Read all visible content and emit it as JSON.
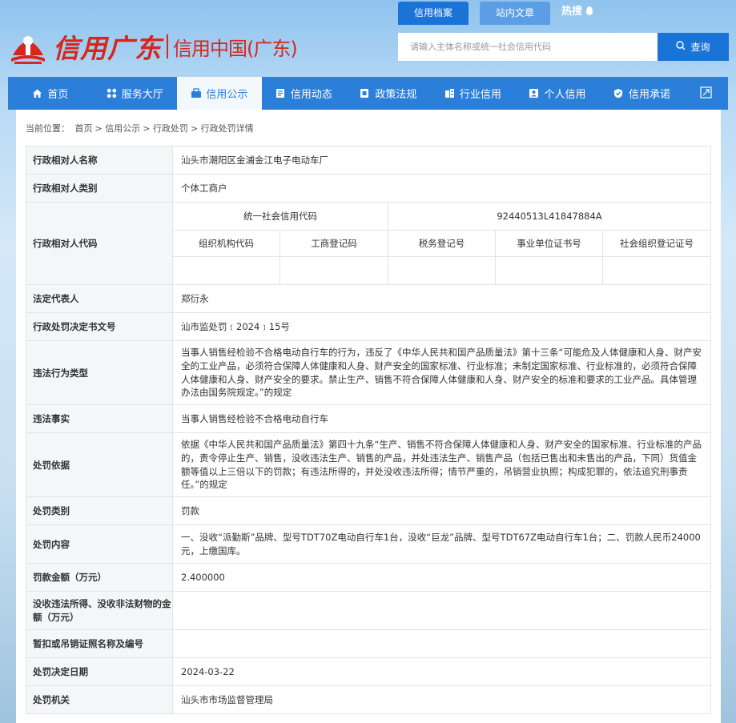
{
  "logo": {
    "script": "信用广东",
    "name": "信用中国(广东)"
  },
  "search": {
    "tabs": [
      "信用档案",
      "站内文章"
    ],
    "hot": "热搜",
    "placeholder": "请输入主体名称或统一社会信用代码",
    "button": "查询"
  },
  "nav": [
    {
      "label": "首页",
      "icon": "home-icon"
    },
    {
      "label": "服务大厅",
      "icon": "grid-icon"
    },
    {
      "label": "信用公示",
      "icon": "notice-icon"
    },
    {
      "label": "信用动态",
      "icon": "news-icon"
    },
    {
      "label": "政策法规",
      "icon": "policy-icon"
    },
    {
      "label": "行业信用",
      "icon": "building-icon"
    },
    {
      "label": "个人信用",
      "icon": "person-icon"
    },
    {
      "label": "信用承诺",
      "icon": "shield-icon"
    }
  ],
  "breadcrumb": {
    "prefix": "当前位置：",
    "items": [
      "首页",
      "信用公示",
      "行政处罚",
      "行政处罚详情"
    ]
  },
  "detail": {
    "name_label": "行政相对人名称",
    "name": "汕头市潮阳区金浦金江电子电动车厂",
    "type_label": "行政相对人类别",
    "type": "个体工商户",
    "code_label": "行政相对人代码",
    "uscc_label": "统一社会信用代码",
    "uscc": "92440513L41847884A",
    "sub_headers": [
      "组织机构代码",
      "工商登记码",
      "税务登记号",
      "事业单位证书号",
      "社会组织登记证号"
    ],
    "legal_rep_label": "法定代表人",
    "legal_rep": "郑衍永",
    "doc_no_label": "行政处罚决定书文号",
    "doc_no": "汕市监处罚﹝2024﹞15号",
    "violation_type_label": "违法行为类型",
    "violation_type": "当事人销售经检验不合格电动自行车的行为，违反了《中华人民共和国产品质量法》第十三条“可能危及人体健康和人身、财产安全的工业产品，必须符合保障人体健康和人身、财产安全的国家标准、行业标准；未制定国家标准、行业标准的，必须符合保障人体健康和人身、财产安全的要求。禁止生产、销售不符合保障人体健康和人身、财产安全的标准和要求的工业产品。具体管理办法由国务院规定。”的规定",
    "facts_label": "违法事实",
    "facts": "当事人销售经检验不合格电动自行车",
    "basis_label": "处罚依据",
    "basis": "依据《中华人民共和国产品质量法》第四十九条“生产、销售不符合保障人体健康和人身、财产安全的国家标准、行业标准的产品的，责令停止生产、销售，没收违法生产、销售的产品，并处违法生产、销售产品（包括已售出和未售出的产品，下同）货值金额等值以上三倍以下的罚款；有违法所得的，并处没收违法所得；情节严重的，吊销营业执照；构成犯罪的，依法追究刑事责任。”的规定",
    "category_label": "处罚类别",
    "category": "罚款",
    "content_label": "处罚内容",
    "content": "一、没收“派勤斯”品牌、型号TDT70Z电动自行车1台，没收“巨龙”品牌、型号TDT67Z电动自行车1台；二、罚款人民币24000元，上缴国库。",
    "fine_label": "罚款金额（万元）",
    "fine": "2.400000",
    "confiscation_label": "没收违法所得、没收非法财物的金额（万元）",
    "confiscation": "",
    "license_label": "暂扣或吊销证照名称及编号",
    "license": "",
    "date_label": "处罚决定日期",
    "date": "2024-03-22",
    "authority_label": "处罚机关",
    "authority": "汕头市市场监督管理局"
  }
}
